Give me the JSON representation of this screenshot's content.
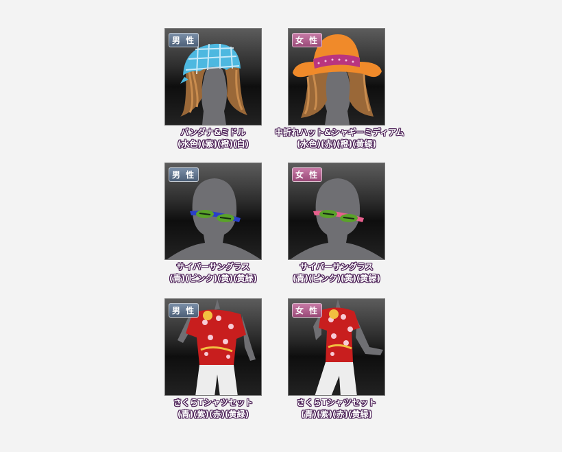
{
  "items": [
    {
      "gender": "男 性",
      "gender_type": "male",
      "name": "バンダナ&ミドル",
      "colors": "(水色)(紫)(橙)(白)",
      "image": "bandana-hair"
    },
    {
      "gender": "女 性",
      "gender_type": "female",
      "name": "中折れハット&シャギーミディアム",
      "colors": "(水色)(赤)(橙)(黄緑)",
      "image": "hat-hair"
    },
    {
      "gender": "男 性",
      "gender_type": "male",
      "name": "サイバーサングラス",
      "colors": "(青)(ピンク)(黄)(黄緑)",
      "image": "sunglasses-blue"
    },
    {
      "gender": "女 性",
      "gender_type": "female",
      "name": "サイバーサングラス",
      "colors": "(青)(ピンク)(黄)(黄緑)",
      "image": "sunglasses-pink"
    },
    {
      "gender": "男 性",
      "gender_type": "male",
      "name": "さくらTシャツセット",
      "colors": "(青)(紫)(赤)(黄緑)",
      "image": "sakura-shirt"
    },
    {
      "gender": "女 性",
      "gender_type": "female",
      "name": "さくらTシャツセット",
      "colors": "(青)(紫)(赤)(黄緑)",
      "image": "sakura-shirt"
    }
  ]
}
